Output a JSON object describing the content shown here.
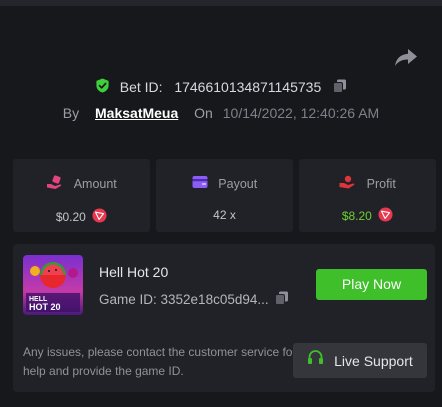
{
  "bet": {
    "label": "Bet ID:",
    "id": "1746610134871145735"
  },
  "byline": {
    "by_label": "By",
    "username": "MaksatMeua",
    "on_label": "On",
    "datetime": "10/14/2022, 12:40:26 AM"
  },
  "stats": {
    "amount": {
      "label": "Amount",
      "value": "$0.20",
      "icon": "money-hand-icon"
    },
    "payout": {
      "label": "Payout",
      "value": "42 x",
      "icon": "wallet-icon"
    },
    "profit": {
      "label": "Profit",
      "value": "$8.20",
      "icon": "profit-hand-icon"
    }
  },
  "game": {
    "name": "Hell Hot 20",
    "id_text": "Game ID: 3352e18c05d94...",
    "thumb_title_line1": "HELL",
    "thumb_title_line2": "HOT 20",
    "play_label": "Play Now"
  },
  "support": {
    "issue_text": "Any issues, please contact the customer service for help and provide the game ID.",
    "button_label": "Live Support"
  },
  "colors": {
    "background": "#17181b",
    "card": "#212227",
    "accent_green": "#3fbf2a",
    "profit_green": "#6cd12e",
    "shield_green": "#3ecf3a",
    "amount_pink": "#e0457b",
    "payout_purple": "#8b5cf6",
    "profit_red": "#e0343a",
    "trx_red": "#e8384f"
  }
}
